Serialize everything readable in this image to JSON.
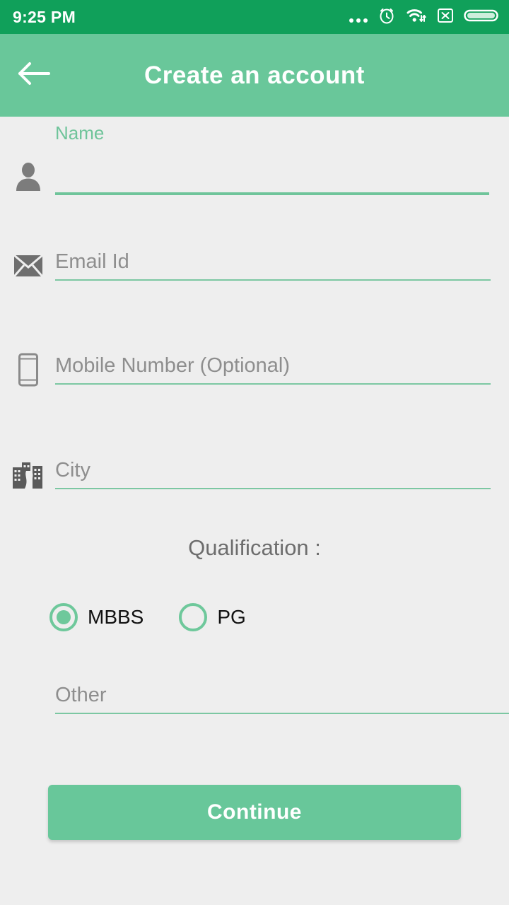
{
  "status_bar": {
    "time": "9:25 PM",
    "background_color": "#10a05a",
    "icons": [
      "more-dots-icon",
      "alarm-clock-icon",
      "wifi-icon",
      "sim-disabled-icon",
      "battery-full-icon"
    ]
  },
  "toolbar": {
    "title": "Create an account",
    "back_icon": "back-arrow-icon",
    "background_color": "#69c79a"
  },
  "theme": {
    "accent": "#69c79a",
    "underline": "#7cc7a2",
    "page_background": "#eeeeee",
    "placeholder_color": "#8e8e8e"
  },
  "form": {
    "fields": [
      {
        "key": "name",
        "icon": "person-icon",
        "floating_label": "Name",
        "value": "",
        "placeholder": "",
        "focused": true
      },
      {
        "key": "email",
        "icon": "envelope-icon",
        "floating_label": "",
        "value": "",
        "placeholder": "Email Id",
        "focused": false
      },
      {
        "key": "mobile",
        "icon": "mobile-phone-icon",
        "floating_label": "",
        "value": "",
        "placeholder": "Mobile Number (Optional)",
        "focused": false
      },
      {
        "key": "city",
        "icon": "city-buildings-icon",
        "floating_label": "",
        "value": "",
        "placeholder": "City",
        "focused": false
      },
      {
        "key": "other",
        "icon": "",
        "floating_label": "",
        "value": "",
        "placeholder": "Other",
        "focused": false
      }
    ],
    "qualification": {
      "title": "Qualification :",
      "options": [
        {
          "label": "MBBS",
          "selected": true
        },
        {
          "label": "PG",
          "selected": false
        }
      ]
    },
    "submit": {
      "label": "Continue",
      "color": "#68c79a"
    }
  }
}
